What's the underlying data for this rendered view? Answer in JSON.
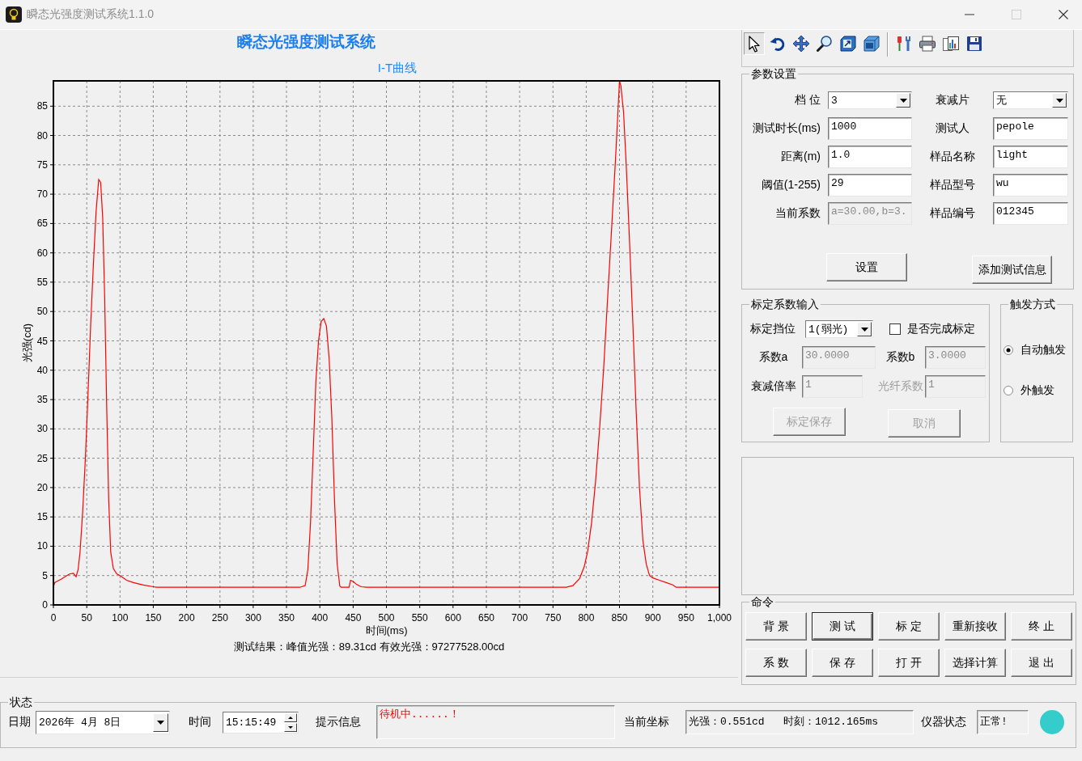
{
  "window": {
    "title": "瞬态光强度测试系统1.1.0",
    "can_maximize": false
  },
  "chart_panel": {
    "heading": "瞬态光强度测试系统",
    "chart_data": {
      "type": "line",
      "title": "I-T曲线",
      "xlabel": "时间(ms)",
      "ylabel": "光强(cd)",
      "grid": true,
      "xlim": [
        0,
        1000
      ],
      "ylim": [
        0,
        89.31
      ],
      "xticks": [
        0,
        50,
        100,
        150,
        200,
        250,
        300,
        350,
        400,
        450,
        500,
        550,
        600,
        650,
        700,
        750,
        800,
        850,
        900,
        950,
        {
          "value": 1000,
          "label": "1,000"
        }
      ],
      "yticks": [
        0,
        5,
        10,
        15,
        20,
        25,
        30,
        35,
        40,
        45,
        50,
        55,
        60,
        65,
        70,
        75,
        80,
        85
      ],
      "x": [
        0,
        2,
        5,
        12,
        20,
        25,
        30,
        34,
        37,
        40,
        44,
        48,
        52,
        56,
        60,
        64,
        68,
        71,
        74,
        77,
        80,
        83,
        86,
        90,
        95,
        100,
        110,
        120,
        135,
        150,
        155,
        370,
        378,
        382,
        386,
        390,
        394,
        398,
        402,
        406,
        410,
        414,
        418,
        422,
        426,
        430,
        432,
        444,
        446,
        450,
        455,
        462,
        470,
        770,
        780,
        790,
        797,
        802,
        808,
        814,
        820,
        826,
        832,
        838,
        844,
        848,
        850,
        852,
        856,
        860,
        865,
        870,
        875,
        880,
        885,
        890,
        895,
        900,
        910,
        920,
        930,
        935,
        1000
      ],
      "series": [
        {
          "color": "#ff0000",
          "values": [
            3.0,
            3.8,
            4.0,
            4.4,
            5.0,
            5.3,
            5.4,
            4.8,
            6.0,
            9,
            16,
            25,
            36,
            48,
            58,
            67,
            72.5,
            72.0,
            66,
            52,
            34,
            18,
            9,
            6.2,
            5.3,
            5.0,
            4.2,
            3.8,
            3.4,
            3.1,
            3.0,
            3.0,
            3.3,
            6,
            14,
            26,
            38,
            45,
            48.3,
            48.8,
            47.5,
            42,
            32,
            18,
            7,
            3.2,
            3.0,
            3.0,
            4.2,
            4.0,
            3.5,
            3.1,
            3.0,
            3.0,
            3.3,
            4.5,
            6.5,
            9,
            14,
            21,
            30,
            40,
            52,
            64,
            76,
            85,
            89.3,
            88.5,
            84,
            75,
            62,
            48,
            33,
            20,
            11,
            7,
            5,
            4.6,
            4.2,
            3.8,
            3.4,
            3.0,
            3.0
          ]
        }
      ]
    },
    "result": "测试结果：峰值光强：89.31cd 有效光强：97277528.00cd"
  },
  "toolbar": {
    "groups": [
      {
        "buttons": [
          {
            "kind": "pointer",
            "selected": true
          },
          {
            "kind": "undo",
            "selected": false
          },
          {
            "kind": "pan",
            "selected": false
          },
          {
            "kind": "zoom",
            "selected": false
          },
          {
            "kind": "resize",
            "selected": false
          },
          {
            "kind": "cube",
            "selected": false
          }
        ]
      },
      {
        "buttons": [
          {
            "kind": "tools",
            "selected": false
          },
          {
            "kind": "print",
            "selected": false
          },
          {
            "kind": "copy",
            "selected": false
          },
          {
            "kind": "save",
            "selected": false
          }
        ]
      }
    ]
  },
  "parameters": {
    "title": "参数设置",
    "fields": [
      {
        "label": "档 位",
        "kind": "dropdown",
        "value": "3",
        "disabled": false
      },
      {
        "label": "衰减片",
        "kind": "dropdown",
        "value": "无",
        "disabled": false
      },
      {
        "label": "测试时长(ms)",
        "kind": "text",
        "value": "1000",
        "disabled": false
      },
      {
        "label": "测试人",
        "kind": "text",
        "value": "pepole",
        "disabled": false
      },
      {
        "label": "距离(m)",
        "kind": "text",
        "value": "1.0",
        "disabled": false
      },
      {
        "label": "样品名称",
        "kind": "text",
        "value": "light",
        "disabled": false
      },
      {
        "label": "阈值(1-255)",
        "kind": "text",
        "value": "29",
        "disabled": false
      },
      {
        "label": "样品型号",
        "kind": "text",
        "value": "wu",
        "disabled": false
      },
      {
        "label": "当前系数",
        "kind": "text",
        "value": "a=30.00,b=3.",
        "disabled": true
      },
      {
        "label": "样品编号",
        "kind": "text",
        "value": "012345",
        "disabled": false
      }
    ],
    "buttons": [
      "设置",
      "添加测试信息"
    ]
  },
  "calibration": {
    "title": "标定系数输入",
    "gear": {
      "label": "标定挡位",
      "value": "1(弱光)"
    },
    "done_check": {
      "label": "是否完成标定",
      "checked": false
    },
    "fields": [
      {
        "label": "系数a",
        "value": "30.0000",
        "disabled": true,
        "label_disabled": false
      },
      {
        "label": "系数b",
        "value": "3.0000",
        "disabled": true,
        "label_disabled": false
      },
      {
        "label": "衰减倍率",
        "value": "1",
        "disabled": true,
        "label_disabled": false
      },
      {
        "label": "光纤系数",
        "value": "1",
        "disabled": true,
        "label_disabled": true
      }
    ],
    "buttons": [
      {
        "label": "标定保存",
        "disabled": true
      },
      {
        "label": "取消",
        "disabled": true
      }
    ]
  },
  "trigger": {
    "title": "触发方式",
    "options": [
      {
        "label": "自动触发",
        "selected": true
      },
      {
        "label": "外触发",
        "selected": false
      }
    ]
  },
  "commands": {
    "title": "命令",
    "buttons": [
      {
        "label": "背 景",
        "focused": false
      },
      {
        "label": "测 试",
        "focused": true
      },
      {
        "label": "标 定",
        "focused": false
      },
      {
        "label": "重新接收",
        "focused": false
      },
      {
        "label": "终 止",
        "focused": false
      },
      {
        "label": "系 数",
        "focused": false
      },
      {
        "label": "保 存",
        "focused": false
      },
      {
        "label": "打 开",
        "focused": false
      },
      {
        "label": "选择计算",
        "focused": false
      },
      {
        "label": "退 出",
        "focused": false
      }
    ]
  },
  "status": {
    "title": "状态",
    "date": {
      "label": "日期",
      "value": "2026年 4月 8日"
    },
    "time": {
      "label": "时间",
      "value": "15:15:49"
    },
    "message": {
      "label": "提示信息",
      "value": "待机中......！"
    },
    "coords": {
      "label": "当前坐标",
      "value": "光强：0.551cd   时刻：1012.165ms"
    },
    "device": {
      "label": "仪器状态",
      "value": "正常!"
    }
  }
}
